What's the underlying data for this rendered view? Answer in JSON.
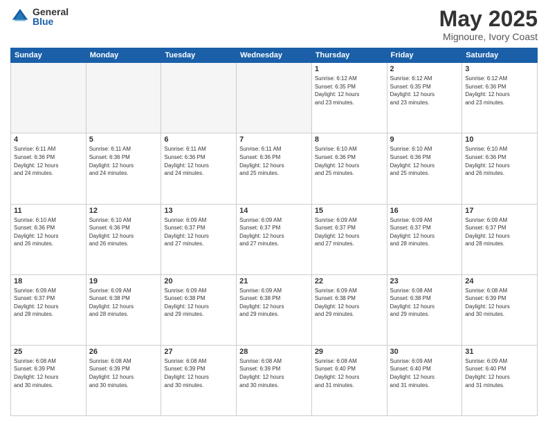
{
  "logo": {
    "general": "General",
    "blue": "Blue"
  },
  "header": {
    "month": "May 2025",
    "location": "Mignoure, Ivory Coast"
  },
  "weekdays": [
    "Sunday",
    "Monday",
    "Tuesday",
    "Wednesday",
    "Thursday",
    "Friday",
    "Saturday"
  ],
  "weeks": [
    [
      {
        "day": "",
        "info": ""
      },
      {
        "day": "",
        "info": ""
      },
      {
        "day": "",
        "info": ""
      },
      {
        "day": "",
        "info": ""
      },
      {
        "day": "1",
        "info": "Sunrise: 6:12 AM\nSunset: 6:35 PM\nDaylight: 12 hours\nand 23 minutes."
      },
      {
        "day": "2",
        "info": "Sunrise: 6:12 AM\nSunset: 6:35 PM\nDaylight: 12 hours\nand 23 minutes."
      },
      {
        "day": "3",
        "info": "Sunrise: 6:12 AM\nSunset: 6:36 PM\nDaylight: 12 hours\nand 23 minutes."
      }
    ],
    [
      {
        "day": "4",
        "info": "Sunrise: 6:11 AM\nSunset: 6:36 PM\nDaylight: 12 hours\nand 24 minutes."
      },
      {
        "day": "5",
        "info": "Sunrise: 6:11 AM\nSunset: 6:36 PM\nDaylight: 12 hours\nand 24 minutes."
      },
      {
        "day": "6",
        "info": "Sunrise: 6:11 AM\nSunset: 6:36 PM\nDaylight: 12 hours\nand 24 minutes."
      },
      {
        "day": "7",
        "info": "Sunrise: 6:11 AM\nSunset: 6:36 PM\nDaylight: 12 hours\nand 25 minutes."
      },
      {
        "day": "8",
        "info": "Sunrise: 6:10 AM\nSunset: 6:36 PM\nDaylight: 12 hours\nand 25 minutes."
      },
      {
        "day": "9",
        "info": "Sunrise: 6:10 AM\nSunset: 6:36 PM\nDaylight: 12 hours\nand 25 minutes."
      },
      {
        "day": "10",
        "info": "Sunrise: 6:10 AM\nSunset: 6:36 PM\nDaylight: 12 hours\nand 26 minutes."
      }
    ],
    [
      {
        "day": "11",
        "info": "Sunrise: 6:10 AM\nSunset: 6:36 PM\nDaylight: 12 hours\nand 26 minutes."
      },
      {
        "day": "12",
        "info": "Sunrise: 6:10 AM\nSunset: 6:36 PM\nDaylight: 12 hours\nand 26 minutes."
      },
      {
        "day": "13",
        "info": "Sunrise: 6:09 AM\nSunset: 6:37 PM\nDaylight: 12 hours\nand 27 minutes."
      },
      {
        "day": "14",
        "info": "Sunrise: 6:09 AM\nSunset: 6:37 PM\nDaylight: 12 hours\nand 27 minutes."
      },
      {
        "day": "15",
        "info": "Sunrise: 6:09 AM\nSunset: 6:37 PM\nDaylight: 12 hours\nand 27 minutes."
      },
      {
        "day": "16",
        "info": "Sunrise: 6:09 AM\nSunset: 6:37 PM\nDaylight: 12 hours\nand 28 minutes."
      },
      {
        "day": "17",
        "info": "Sunrise: 6:09 AM\nSunset: 6:37 PM\nDaylight: 12 hours\nand 28 minutes."
      }
    ],
    [
      {
        "day": "18",
        "info": "Sunrise: 6:09 AM\nSunset: 6:37 PM\nDaylight: 12 hours\nand 28 minutes."
      },
      {
        "day": "19",
        "info": "Sunrise: 6:09 AM\nSunset: 6:38 PM\nDaylight: 12 hours\nand 28 minutes."
      },
      {
        "day": "20",
        "info": "Sunrise: 6:09 AM\nSunset: 6:38 PM\nDaylight: 12 hours\nand 29 minutes."
      },
      {
        "day": "21",
        "info": "Sunrise: 6:09 AM\nSunset: 6:38 PM\nDaylight: 12 hours\nand 29 minutes."
      },
      {
        "day": "22",
        "info": "Sunrise: 6:09 AM\nSunset: 6:38 PM\nDaylight: 12 hours\nand 29 minutes."
      },
      {
        "day": "23",
        "info": "Sunrise: 6:08 AM\nSunset: 6:38 PM\nDaylight: 12 hours\nand 29 minutes."
      },
      {
        "day": "24",
        "info": "Sunrise: 6:08 AM\nSunset: 6:39 PM\nDaylight: 12 hours\nand 30 minutes."
      }
    ],
    [
      {
        "day": "25",
        "info": "Sunrise: 6:08 AM\nSunset: 6:39 PM\nDaylight: 12 hours\nand 30 minutes."
      },
      {
        "day": "26",
        "info": "Sunrise: 6:08 AM\nSunset: 6:39 PM\nDaylight: 12 hours\nand 30 minutes."
      },
      {
        "day": "27",
        "info": "Sunrise: 6:08 AM\nSunset: 6:39 PM\nDaylight: 12 hours\nand 30 minutes."
      },
      {
        "day": "28",
        "info": "Sunrise: 6:08 AM\nSunset: 6:39 PM\nDaylight: 12 hours\nand 30 minutes."
      },
      {
        "day": "29",
        "info": "Sunrise: 6:08 AM\nSunset: 6:40 PM\nDaylight: 12 hours\nand 31 minutes."
      },
      {
        "day": "30",
        "info": "Sunrise: 6:09 AM\nSunset: 6:40 PM\nDaylight: 12 hours\nand 31 minutes."
      },
      {
        "day": "31",
        "info": "Sunrise: 6:09 AM\nSunset: 6:40 PM\nDaylight: 12 hours\nand 31 minutes."
      }
    ]
  ]
}
